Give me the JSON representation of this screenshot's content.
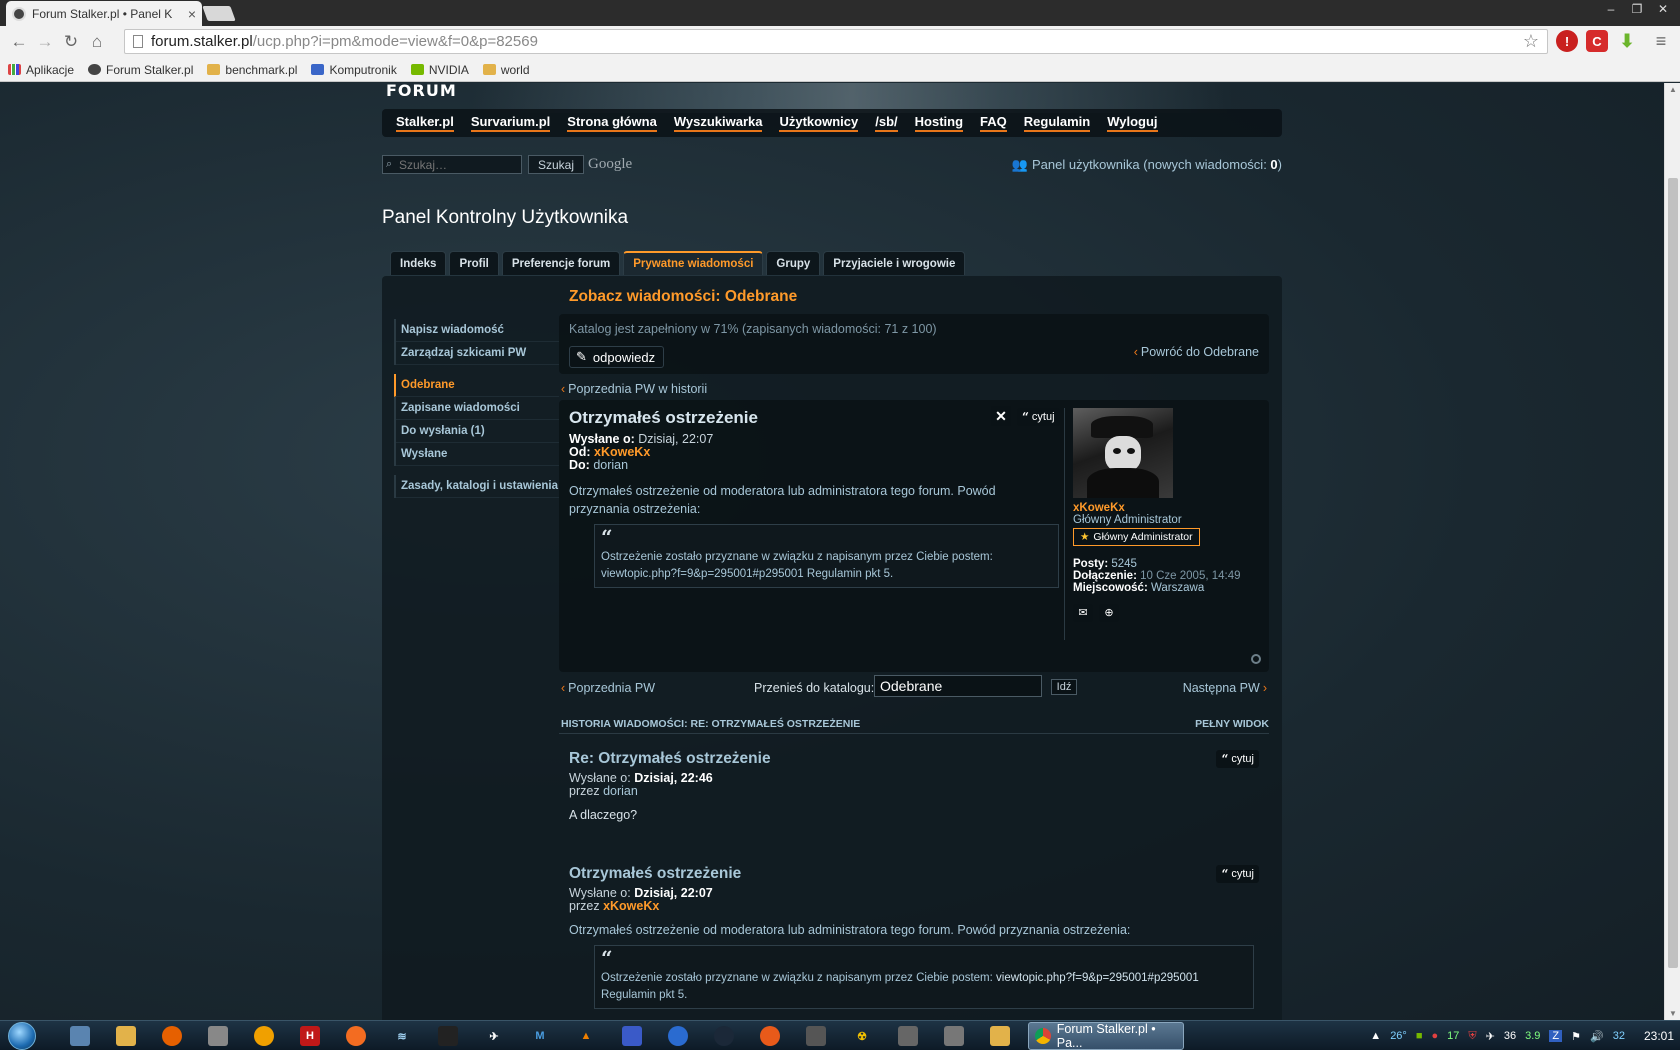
{
  "browser": {
    "tab_title": "Forum Stalker.pl • Panel K",
    "tab_close": "×",
    "url_host": "forum.stalker.pl",
    "url_path": "/ucp.php?i=pm&mode=view&f=0&p=82569",
    "bookmarks": [
      "Aplikacje",
      "Forum Stalker.pl",
      "benchmark.pl",
      "Komputronik",
      "NVIDIA",
      "world"
    ]
  },
  "forum": {
    "logo": "FORUM",
    "nav": [
      "Stalker.pl",
      "Survarium.pl",
      "Strona główna",
      "Wyszukiwarka",
      "Użytkownicy",
      "/sb/",
      "Hosting",
      "FAQ",
      "Regulamin",
      "Wyloguj"
    ],
    "search_placeholder": "Szukaj…",
    "search_button": "Szukaj",
    "google": "Google",
    "ucp_link_text": "Panel użytkownika (nowych wiadomości: ",
    "ucp_new_count": "0",
    "ucp_link_close": ")"
  },
  "page_title": "Panel Kontrolny Użytkownika",
  "tabs": [
    "Indeks",
    "Profil",
    "Preferencje forum",
    "Prywatne wiadomości",
    "Grupy",
    "Przyjaciele i wrogowie"
  ],
  "sidemenu": {
    "group1": [
      "Napisz wiadomość",
      "Zarządzaj szkicami PW"
    ],
    "group2": [
      "Odebrane",
      "Zapisane wiadomości",
      "Do wysłania (1)",
      "Wysłane"
    ],
    "group3": [
      "Zasady, katalogi i ustawienia"
    ]
  },
  "view": {
    "heading": "Zobacz wiadomości: Odebrane",
    "quota": "Katalog jest zapełniony w 71% (zapisanych wiadomości: 71 z 100)",
    "reply_button": "odpowiedz",
    "back_link": "Powróć do Odebrane",
    "prev_history": "Poprzednia PW w historii"
  },
  "message": {
    "title": "Otrzymałeś ostrzeżenie",
    "sent_label": "Wysłane o:",
    "sent_value": "Dzisiaj, 22:07",
    "from_label": "Od:",
    "from_value": "xKoweKx",
    "to_label": "Do:",
    "to_value": "dorian",
    "body": "Otrzymałeś ostrzeżenie od moderatora lub administratora tego forum. Powód przyznania ostrzeżenia:",
    "quote": "Ostrzeżenie zostało przyznane w związku z napisanym przez Ciebie postem: viewtopic.php?f=9&p=295001#p295001 Regulamin pkt 5.",
    "delete_glyph": "✕",
    "quote_button": "cytuj"
  },
  "profile": {
    "username": "xKoweKx",
    "rank": "Główny Administrator",
    "rank_badge": "Główny Administrator",
    "posts_label": "Posty:",
    "posts_value": "5245",
    "joined_label": "Dołączenie:",
    "joined_value": "10 Cze 2005, 14:49",
    "location_label": "Miejscowość:",
    "location_value": "Warszawa"
  },
  "pager": {
    "prev": "Poprzednia PW",
    "move_label": "Przenieś do katalogu:",
    "folder_value": "Odebrane",
    "go_button": "Idź",
    "next": "Następna PW"
  },
  "history": {
    "header": "HISTORIA WIADOMOŚCI: RE: OTRZYMAŁEŚ OSTRZEŻENIE",
    "full_view": "PEŁNY WIDOK",
    "posts": [
      {
        "title": "Re: Otrzymałeś ostrzeżenie",
        "sent_label": "Wysłane o:",
        "sent_value": "Dzisiaj, 22:46",
        "by_label": "przez",
        "by_value": "dorian",
        "body": "A dlaczego?",
        "quote_button": "cytuj"
      },
      {
        "title": "Otrzymałeś ostrzeżenie",
        "sent_label": "Wysłane o:",
        "sent_value": "Dzisiaj, 22:07",
        "by_label": "przez",
        "by_value": "xKoweKx",
        "body": "Otrzymałeś ostrzeżenie od moderatora lub administratora tego forum. Powód przyznania ostrzeżenia:",
        "quote_prefix": "Ostrzeżenie zostało przyznane w związku z napisanym przez Ciebie postem: ",
        "quote_link": "viewtopic.php?f=9&p=295001#p295001",
        "quote_suffix": "Regulamin pkt 5.",
        "quote_button": "cytuj"
      }
    ]
  },
  "taskbar": {
    "task_label": "Forum Stalker.pl • Pa...",
    "tray": {
      "temp": "26°",
      "n1": "17",
      "n2": "36",
      "n3": "3.9",
      "n4": "32",
      "clock": "23:01"
    }
  }
}
